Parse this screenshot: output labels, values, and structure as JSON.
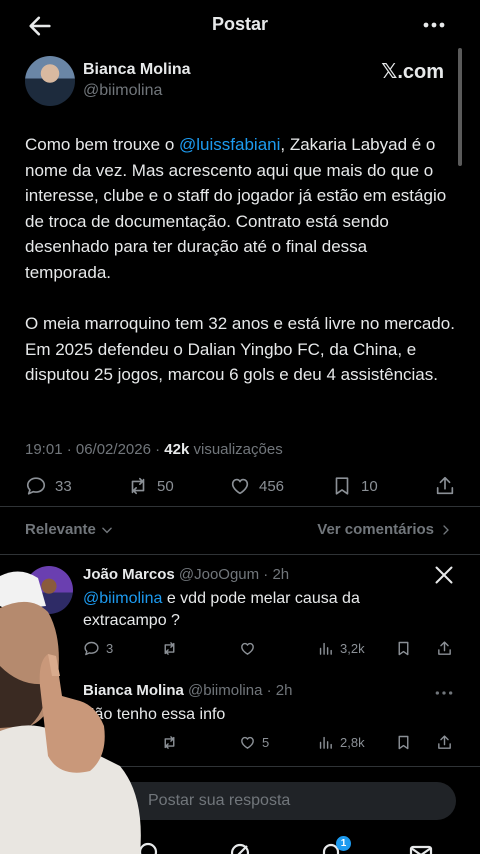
{
  "header": {
    "title": "Postar"
  },
  "post": {
    "author_name": "Bianca Molina",
    "author_handle": "@biimolina",
    "source_brand": "𝕏.com",
    "text_p1_before": "Como bem trouxe o ",
    "text_p1_mention": "@luissfabiani",
    "text_p1_after": ", Zakaria Labyad é o nome da vez. Mas acrescento aqui que mais do que o interesse, clube e o staff do jogador já estão em estágio de troca de documentação. Contrato está sendo desenhado para ter duração até o final dessa temporada.",
    "text_p2": "O meia marroquino tem 32 anos e está livre no mercado. Em 2025 defendeu o Dalian Yingbo FC, da China, e disputou 25 jogos, marcou 6 gols e deu 4 assistências.",
    "timestamp": "19:01 · 06/02/2026 · ",
    "views_count": "42k",
    "views_label": " visualizações",
    "replies": "33",
    "reposts": "50",
    "likes": "456",
    "bookmarks": "10"
  },
  "sort": {
    "label": "Relevante",
    "see_comments": "Ver comentários"
  },
  "replies": [
    {
      "name": "João Marcos",
      "handle_time": " @JooOgum · 2h",
      "mention": "@biimolina",
      "text": " e vdd pode melar causa da extracampo ?",
      "replies": "3",
      "views": "3,2k"
    },
    {
      "name": "Bianca Molina",
      "handle_time": " @biimolina · 2h",
      "text": "Não tenho essa info",
      "likes": "5",
      "views": "2,8k"
    }
  ],
  "compose": {
    "placeholder": "Postar sua resposta"
  },
  "nav": {
    "notifications_badge": "1"
  },
  "colors": {
    "accent": "#1d9bf0",
    "background": "#000000",
    "text": "#e7e9ea",
    "muted": "#71767b"
  },
  "icons": [
    "back-arrow-icon",
    "more-icon",
    "reply-icon",
    "repost-icon",
    "like-icon",
    "bookmark-icon",
    "share-icon",
    "x-logo-icon",
    "views-icon",
    "chevron-down-icon",
    "chevron-right-icon",
    "search-icon",
    "grok-icon",
    "notifications-icon",
    "messages-icon"
  ]
}
